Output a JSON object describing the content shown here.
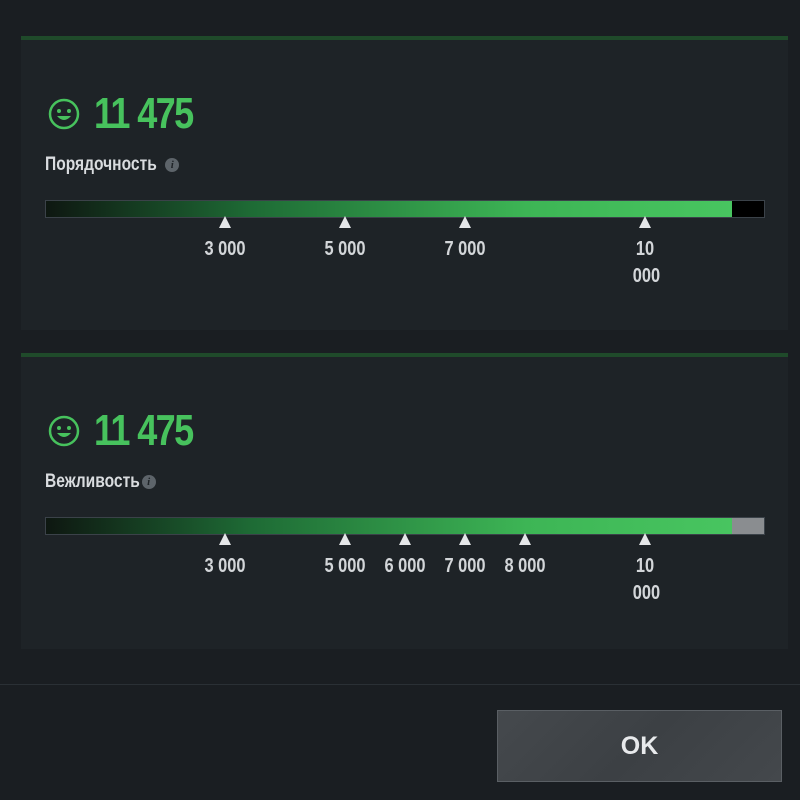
{
  "colors": {
    "accent_green": "#47c25d",
    "bar_remainder_1": "#000000",
    "bar_remainder_2": "#8a8d90"
  },
  "panels": [
    {
      "icon": "smiley-face-icon",
      "score": "11 475",
      "label": "Порядочность",
      "info_icon": "info-icon",
      "progress_percent": 95.5,
      "ticks": [
        {
          "label": "3 000",
          "percent": 25
        },
        {
          "label": "5 000",
          "percent": 41.7
        },
        {
          "label": "7 000",
          "percent": 58.3
        },
        {
          "label": "10 000",
          "percent": 83.3
        }
      ]
    },
    {
      "icon": "smiley-face-icon",
      "score": "11 475",
      "label": "Вежливость",
      "info_icon": "info-icon",
      "progress_percent": 95.5,
      "ticks": [
        {
          "label": "3 000",
          "percent": 25
        },
        {
          "label": "5 000",
          "percent": 41.7
        },
        {
          "label": "6 000",
          "percent": 50
        },
        {
          "label": "7 000",
          "percent": 58.3
        },
        {
          "label": "8 000",
          "percent": 66.7
        },
        {
          "label": "10 000",
          "percent": 83.3
        }
      ]
    }
  ],
  "footer": {
    "ok_label": "OK"
  }
}
